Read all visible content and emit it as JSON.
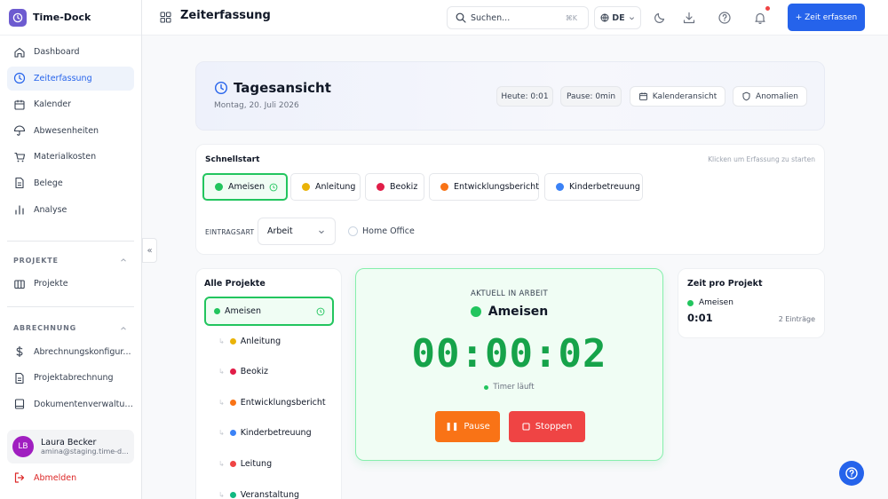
{
  "app": {
    "name": "Time-Dock"
  },
  "sidebar": {
    "items": [
      {
        "label": "Dashboard",
        "icon": "home-icon"
      },
      {
        "label": "Zeiterfassung",
        "icon": "clock-icon",
        "active": true
      },
      {
        "label": "Kalender",
        "icon": "calendar-icon"
      },
      {
        "label": "Abwesenheiten",
        "icon": "umbrella-icon"
      },
      {
        "label": "Materialkosten",
        "icon": "cart-icon"
      },
      {
        "label": "Belege",
        "icon": "receipt-icon"
      },
      {
        "label": "Analyse",
        "icon": "bar-chart-icon"
      }
    ],
    "sections": [
      {
        "title": "PROJEKTE",
        "items": [
          {
            "label": "Projekte",
            "icon": "folder-icon"
          }
        ]
      },
      {
        "title": "ABRECHNUNG",
        "items": [
          {
            "label": "Abrechnungskonfigur...",
            "icon": "dollar-icon"
          },
          {
            "label": "Projektabrechnung",
            "icon": "document-icon"
          },
          {
            "label": "Dokumentenverwaltung",
            "icon": "book-icon"
          }
        ]
      }
    ],
    "user": {
      "initials": "LB",
      "name": "Laura Becker",
      "email": "amina@staging.time-d..."
    },
    "logout_label": "Abmelden",
    "collapse_glyph": "«"
  },
  "topbar": {
    "title": "Zeiterfassung",
    "search_placeholder": "Suchen...",
    "search_shortcut": "⌘K",
    "language": "DE",
    "primary_button": "+ Zeit erfassen"
  },
  "hero": {
    "title": "Tagesansicht",
    "date": "Montag, 20. Juli 2026",
    "today_chip": "Heute: 0:01",
    "pause_chip": "Pause: 0min",
    "calendar_button": "Kalenderansicht",
    "anomalies_button": "Anomalien"
  },
  "quickstart": {
    "title": "Schnellstart",
    "hint": "Klicken um Erfassung zu starten",
    "buttons": [
      {
        "label": "Ameisen",
        "color": "#22c55e",
        "selected": true
      },
      {
        "label": "Anleitung",
        "color": "#eab308"
      },
      {
        "label": "Beokiz",
        "color": "#e11d48"
      },
      {
        "label": "Entwicklungsbericht",
        "color": "#f97316"
      },
      {
        "label": "Kinderbetreuung",
        "color": "#3b82f6"
      }
    ],
    "entry_type_label": "EINTRAGSART",
    "entry_type_value": "Arbeit",
    "home_office_label": "Home Office"
  },
  "projects": {
    "title": "Alle Projekte",
    "items": [
      {
        "label": "Ameisen",
        "color": "#22c55e",
        "selected": true
      },
      {
        "label": "Anleitung",
        "color": "#eab308"
      },
      {
        "label": "Beokiz",
        "color": "#e11d48"
      },
      {
        "label": "Entwicklungsbericht",
        "color": "#f97316"
      },
      {
        "label": "Kinderbetreuung",
        "color": "#3b82f6"
      },
      {
        "label": "Leitung",
        "color": "#ef4444"
      },
      {
        "label": "Veranstaltung",
        "color": "#10b981"
      }
    ]
  },
  "timer": {
    "caption": "AKTUELL IN ARBEIT",
    "project": "Ameisen",
    "project_color": "#22c55e",
    "elapsed": "00:00:02",
    "status": "Timer läuft",
    "pause_label": "Pause",
    "stop_label": "Stoppen",
    "pause_color": "#f97316",
    "stop_color": "#ef4444"
  },
  "time_per_project": {
    "title": "Zeit pro Projekt",
    "entries": [
      {
        "project": "Ameisen",
        "color": "#22c55e",
        "time": "0:01",
        "count": "2 Einträge"
      }
    ]
  },
  "colors": {
    "accent": "#2563eb",
    "success": "#16a34a"
  }
}
